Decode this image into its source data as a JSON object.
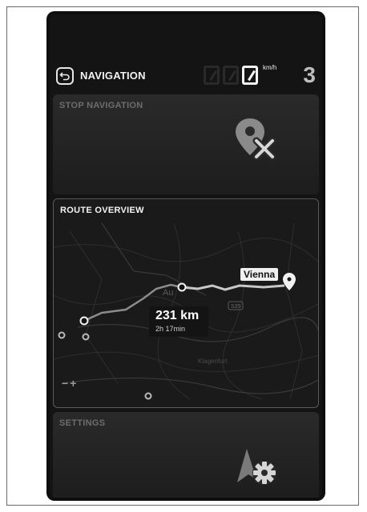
{
  "header": {
    "title": "NAVIGATION",
    "speed_unit": "km/h",
    "gear": "3"
  },
  "stop_navigation": {
    "label": "STOP NAVIGATION",
    "icon": "stop-navigation-icon"
  },
  "route_overview": {
    "label": "ROUTE OVERVIEW",
    "distance": "231 km",
    "duration": "2h 17min",
    "destination": "Vienna",
    "road_sign": "S35",
    "map_place_label": "Au",
    "map_city_label": "Klagenfurt"
  },
  "settings": {
    "label": "SETTINGS",
    "icon": "navigation-settings-icon"
  },
  "colors": {
    "background": "#141414",
    "panel": "#242424",
    "text": "#f2f2f2",
    "muted": "#6d6d6d"
  }
}
